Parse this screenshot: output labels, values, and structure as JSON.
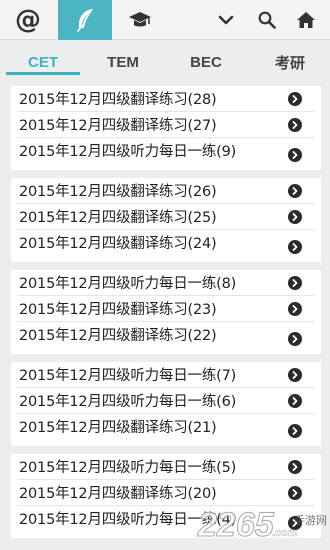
{
  "toolbar": {
    "at_symbol": "@",
    "accent_color": "#4bb6c2",
    "icons": [
      "at-icon",
      "feather-icon",
      "graduation-cap-icon",
      "chevron-down-icon",
      "search-icon",
      "home-icon"
    ]
  },
  "tabs": [
    {
      "label": "CET",
      "active": true
    },
    {
      "label": "TEM",
      "active": false
    },
    {
      "label": "BEC",
      "active": false
    },
    {
      "label": "考研",
      "active": false
    }
  ],
  "groups": [
    {
      "items": [
        {
          "title": "2015年12月四级翻译练习(28)"
        },
        {
          "title": "2015年12月四级翻译练习(27)"
        },
        {
          "title": "2015年12月四级听力每日一练(9)"
        }
      ]
    },
    {
      "items": [
        {
          "title": "2015年12月四级翻译练习(26)"
        },
        {
          "title": "2015年12月四级翻译练习(25)"
        },
        {
          "title": "2015年12月四级翻译练习(24)"
        }
      ]
    },
    {
      "items": [
        {
          "title": "2015年12月四级听力每日一练(8)"
        },
        {
          "title": "2015年12月四级翻译练习(23)"
        },
        {
          "title": "2015年12月四级翻译练习(22)"
        }
      ]
    },
    {
      "items": [
        {
          "title": "2015年12月四级听力每日一练(7)"
        },
        {
          "title": "2015年12月四级听力每日一练(6)"
        },
        {
          "title": "2015年12月四级翻译练习(21)"
        }
      ]
    },
    {
      "items": [
        {
          "title": "2015年12月四级听力每日一练(5)"
        },
        {
          "title": "2015年12月四级翻译练习(20)"
        },
        {
          "title": "2015年12月四级听力每日一练(4)"
        }
      ]
    }
  ],
  "watermark": {
    "brand": "2265",
    "suffix": ".com",
    "label": "手游网"
  }
}
